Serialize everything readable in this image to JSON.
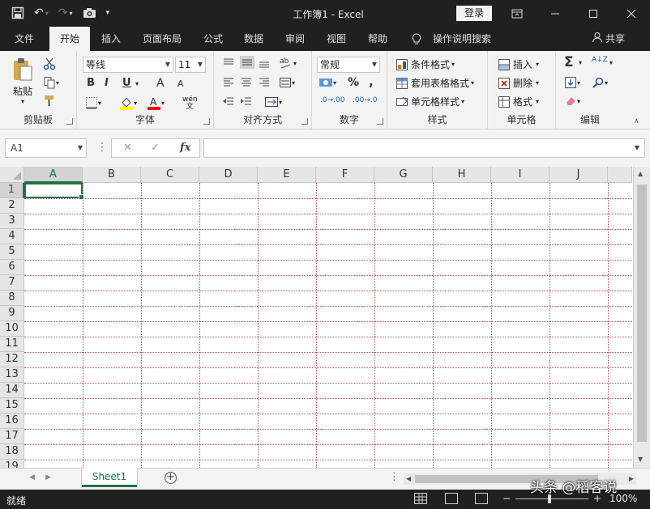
{
  "titlebar": {
    "title": "工作簿1  -  Excel",
    "login_label": "登录"
  },
  "ribbon_tabs": [
    "文件",
    "开始",
    "插入",
    "页面布局",
    "公式",
    "数据",
    "审阅",
    "视图",
    "帮助",
    "操作说明搜索"
  ],
  "share_label": "共享",
  "clipboard": {
    "paste_label": "粘贴",
    "group_label": "剪贴板"
  },
  "font": {
    "name": "等线",
    "size": "11",
    "group_label": "字体",
    "bold": "B",
    "italic": "I",
    "underline": "U",
    "grow": "A",
    "shrink": "A",
    "phonetic": "wén"
  },
  "alignment": {
    "group_label": "对齐方式"
  },
  "number": {
    "format": "常规",
    "group_label": "数字",
    "percent": "%",
    "comma": ",",
    "inc_dec": ".00→.0",
    "dec_inc": ".0→.00"
  },
  "styles": {
    "conditional": "条件格式",
    "table": "套用表格格式",
    "cell": "单元格样式",
    "group_label": "样式"
  },
  "cells_group": {
    "insert": "插入",
    "delete": "删除",
    "format": "格式",
    "group_label": "单元格"
  },
  "editing": {
    "sum": "Σ",
    "sort": "A↓Z",
    "group_label": "编辑"
  },
  "formula_bar": {
    "name_box": "A1",
    "fx": "fx",
    "cancel": "✕",
    "enter": "✓",
    "formula_value": ""
  },
  "columns": [
    "A",
    "B",
    "C",
    "D",
    "E",
    "F",
    "G",
    "H",
    "I",
    "J"
  ],
  "rows": [
    "1",
    "2",
    "3",
    "4",
    "5",
    "6",
    "7",
    "8",
    "9",
    "10",
    "11",
    "12",
    "13",
    "14",
    "15",
    "16",
    "17",
    "18",
    "19"
  ],
  "sheet": {
    "name": "Sheet1",
    "add": "+"
  },
  "status": {
    "text": "就绪",
    "zoom": "100%",
    "zoom_minus": "−",
    "zoom_plus": "+"
  },
  "watermark": "头条 @稻客说",
  "colors": {
    "accent": "#217346",
    "titlebar": "#202020",
    "grid": "#b05050"
  }
}
